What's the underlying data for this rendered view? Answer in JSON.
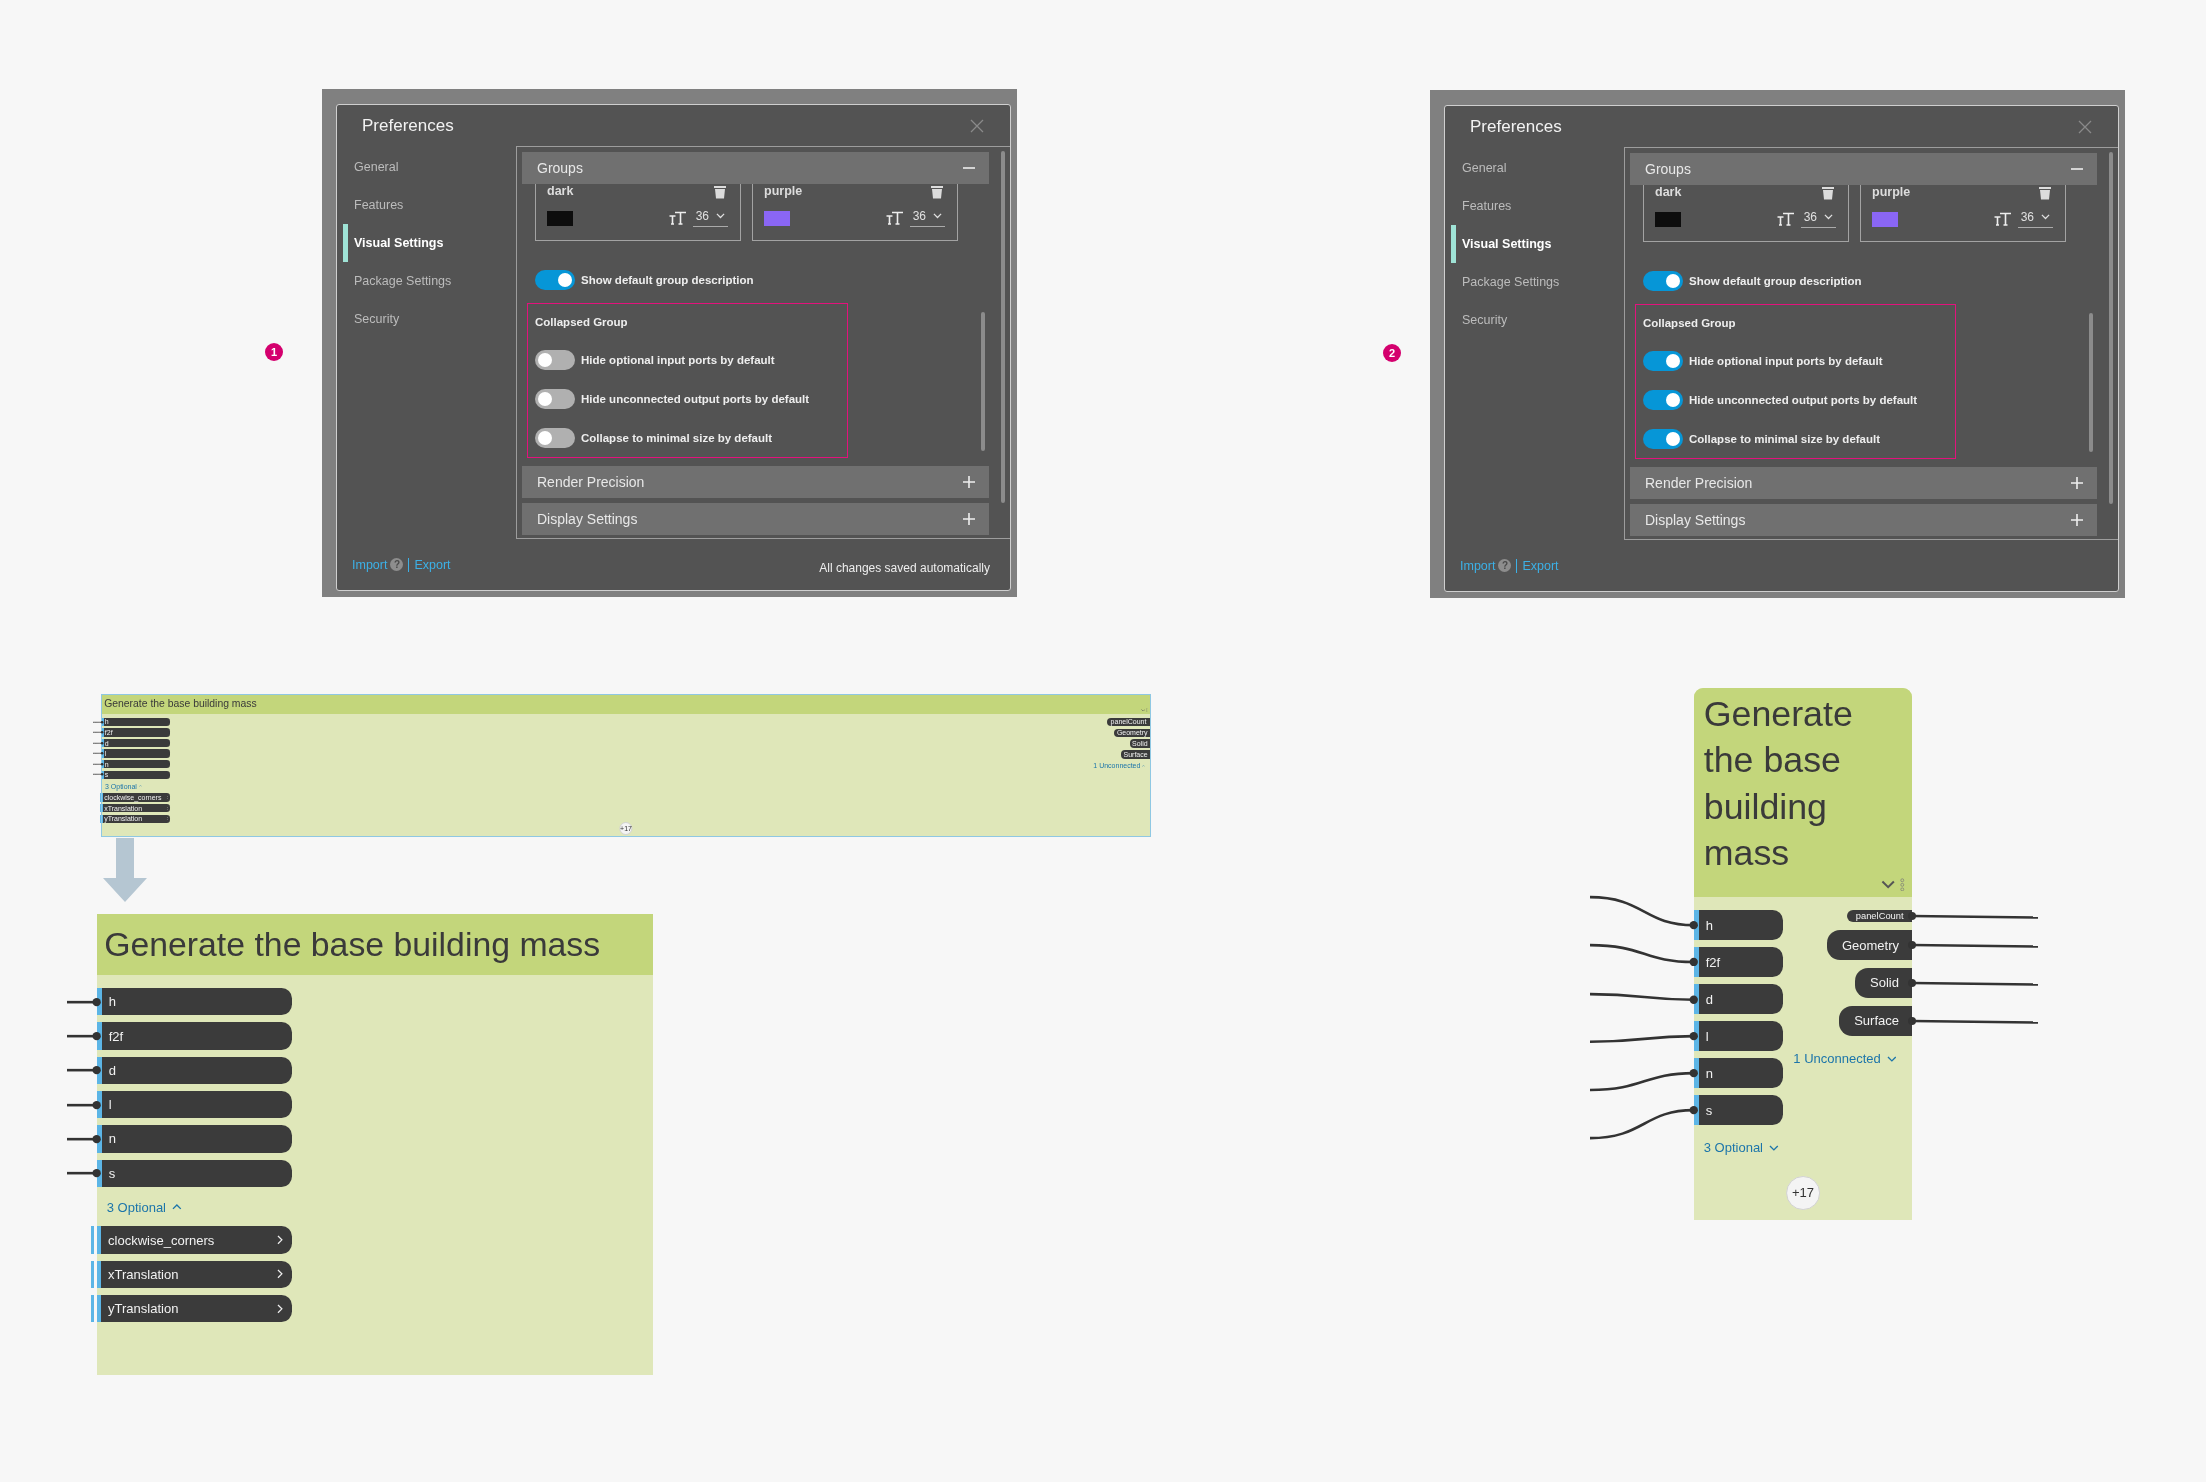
{
  "comparisons": [
    {
      "badge": "1",
      "preferences": {
        "title": "Preferences",
        "nav": [
          {
            "label": "General",
            "selected": false
          },
          {
            "label": "Features",
            "selected": false
          },
          {
            "label": "Visual Settings",
            "selected": true
          },
          {
            "label": "Package Settings",
            "selected": false
          },
          {
            "label": "Security",
            "selected": false
          }
        ],
        "sections": [
          {
            "title": "Groups",
            "expanded": true,
            "styles": [
              {
                "name": "dark",
                "color": "#0d0d0d",
                "font_size": "36"
              },
              {
                "name": "purple",
                "color": "#8a66f4",
                "font_size": "36"
              }
            ],
            "toggles": [
              {
                "label": "Show default group description",
                "on": true
              }
            ],
            "subsection": {
              "title": "Collapsed Group",
              "highlighted": true,
              "toggles": [
                {
                  "label": "Hide optional input ports by default",
                  "on": false
                },
                {
                  "label": "Hide unconnected output ports by default",
                  "on": false
                },
                {
                  "label": "Collapse to minimal size by default",
                  "on": false
                }
              ]
            }
          },
          {
            "title": "Render Precision",
            "expanded": false
          },
          {
            "title": "Display Settings",
            "expanded": false
          }
        ],
        "footer": {
          "import": "Import",
          "help": "?",
          "export": "Export",
          "status": "All changes saved automatically"
        }
      }
    },
    {
      "badge": "2",
      "preferences": {
        "title": "Preferences",
        "nav": [
          {
            "label": "General",
            "selected": false
          },
          {
            "label": "Features",
            "selected": false
          },
          {
            "label": "Visual Settings",
            "selected": true
          },
          {
            "label": "Package Settings",
            "selected": false
          },
          {
            "label": "Security",
            "selected": false
          }
        ],
        "sections": [
          {
            "title": "Groups",
            "expanded": true,
            "styles": [
              {
                "name": "dark",
                "color": "#0d0d0d",
                "font_size": "36"
              },
              {
                "name": "purple",
                "color": "#8a66f4",
                "font_size": "36"
              }
            ],
            "toggles": [
              {
                "label": "Show default group description",
                "on": true
              }
            ],
            "subsection": {
              "title": "Collapsed Group",
              "highlighted": true,
              "toggles": [
                {
                  "label": "Hide optional input ports by default",
                  "on": true
                },
                {
                  "label": "Hide unconnected output ports by default",
                  "on": true
                },
                {
                  "label": "Collapse to minimal size by default",
                  "on": true
                }
              ]
            }
          },
          {
            "title": "Render Precision",
            "expanded": false
          },
          {
            "title": "Display Settings",
            "expanded": false
          }
        ],
        "footer": {
          "import": "Import",
          "help": "?",
          "export": "Export"
        }
      }
    }
  ],
  "group_nodes": [
    {
      "kind": "strip",
      "title": "Generate the base building mass",
      "inputs": [
        {
          "label": "h",
          "connected": true
        },
        {
          "label": "f2f",
          "connected": true
        },
        {
          "label": "d",
          "connected": true
        },
        {
          "label": "l",
          "connected": true
        },
        {
          "label": "n",
          "connected": true
        },
        {
          "label": "s",
          "connected": true
        }
      ],
      "optional_toggle": "3 Optional",
      "optional_expanded": true,
      "optional_inputs": [
        {
          "label": "clockwise_corners"
        },
        {
          "label": "xTranslation"
        },
        {
          "label": "yTranslation"
        }
      ],
      "outputs": [
        {
          "label": "panelCount",
          "kind": "compact"
        },
        {
          "label": "Geometry",
          "kind": "normal"
        },
        {
          "label": "Solid",
          "kind": "normal"
        },
        {
          "label": "Surface",
          "kind": "normal"
        }
      ],
      "unconnected_toggle": "1 Unconnected",
      "unconnected_expanded": true,
      "hidden_count": "+17"
    },
    {
      "kind": "large",
      "title": "Generate the base building mass",
      "inputs": [
        {
          "label": "h",
          "connected": true
        },
        {
          "label": "f2f",
          "connected": true
        },
        {
          "label": "d",
          "connected": true
        },
        {
          "label": "l",
          "connected": true
        },
        {
          "label": "n",
          "connected": true
        },
        {
          "label": "s",
          "connected": true
        }
      ],
      "optional_toggle": "3 Optional",
      "optional_expanded": true,
      "optional_inputs": [
        {
          "label": "clockwise_corners"
        },
        {
          "label": "xTranslation"
        },
        {
          "label": "yTranslation"
        }
      ]
    },
    {
      "kind": "collapsed",
      "title": "Generate the base building mass",
      "inputs": [
        {
          "label": "h",
          "connected": true
        },
        {
          "label": "f2f",
          "connected": true
        },
        {
          "label": "d",
          "connected": true
        },
        {
          "label": "l",
          "connected": true
        },
        {
          "label": "n",
          "connected": true
        },
        {
          "label": "s",
          "connected": true
        }
      ],
      "optional_toggle": "3 Optional",
      "optional_expanded": false,
      "outputs": [
        {
          "label": "panelCount",
          "kind": "compact",
          "connected": true
        },
        {
          "label": "Geometry",
          "kind": "normal",
          "connected": true
        },
        {
          "label": "Solid",
          "kind": "normal",
          "connected": true
        },
        {
          "label": "Surface",
          "kind": "normal",
          "connected": true
        }
      ],
      "unconnected_toggle": "1 Unconnected",
      "unconnected_expanded": false,
      "hidden_count": "+17"
    }
  ]
}
